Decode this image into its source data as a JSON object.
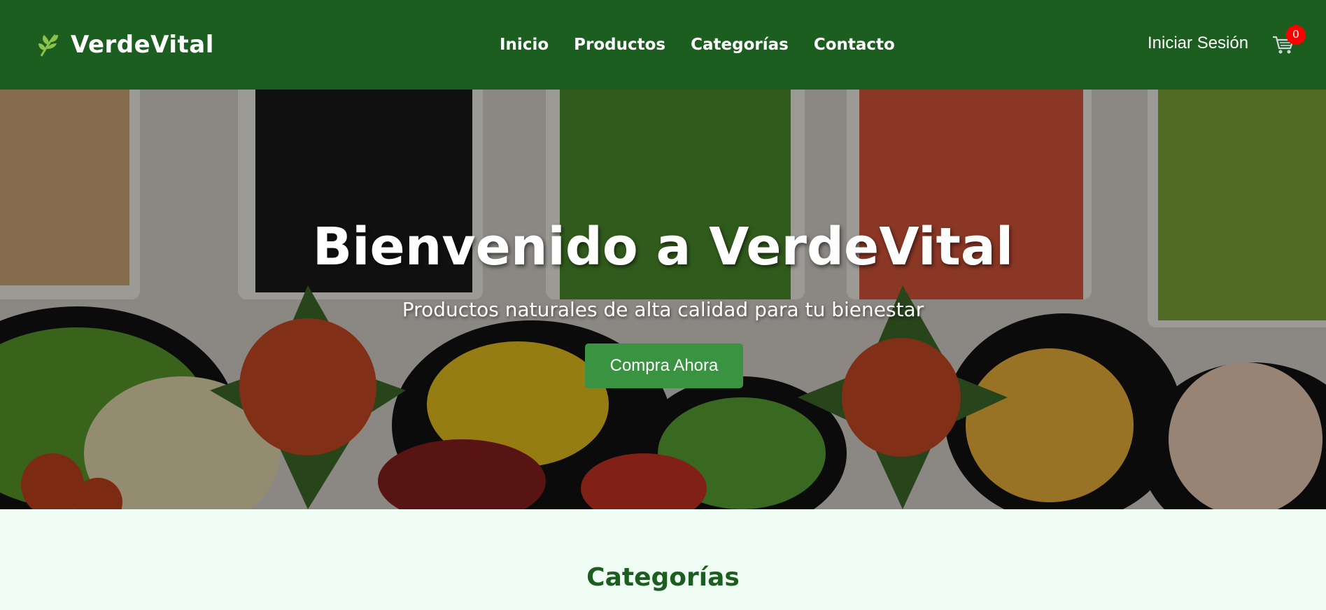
{
  "brand": {
    "name": "VerdeVital",
    "icon": "leaf-icon",
    "icon_color": "#8bc34a"
  },
  "nav": {
    "items": [
      {
        "label": "Inicio"
      },
      {
        "label": "Productos"
      },
      {
        "label": "Categorías"
      },
      {
        "label": "Contacto"
      }
    ],
    "login_label": "Iniciar Sesión",
    "cart_icon": "cart-icon",
    "cart_count": "0"
  },
  "hero": {
    "title": "Bienvenido a VerdeVital",
    "subtitle": "Productos naturales de alta calidad para tu bienestar",
    "cta_label": "Compra Ahora",
    "image": "vegetable-salad-bar-photo"
  },
  "sections": {
    "categories_title": "Categorías"
  },
  "colors": {
    "header_bg": "#1b5e20",
    "accent": "#3a9340",
    "page_bg": "#f0fdf4",
    "badge": "#ff0000"
  }
}
